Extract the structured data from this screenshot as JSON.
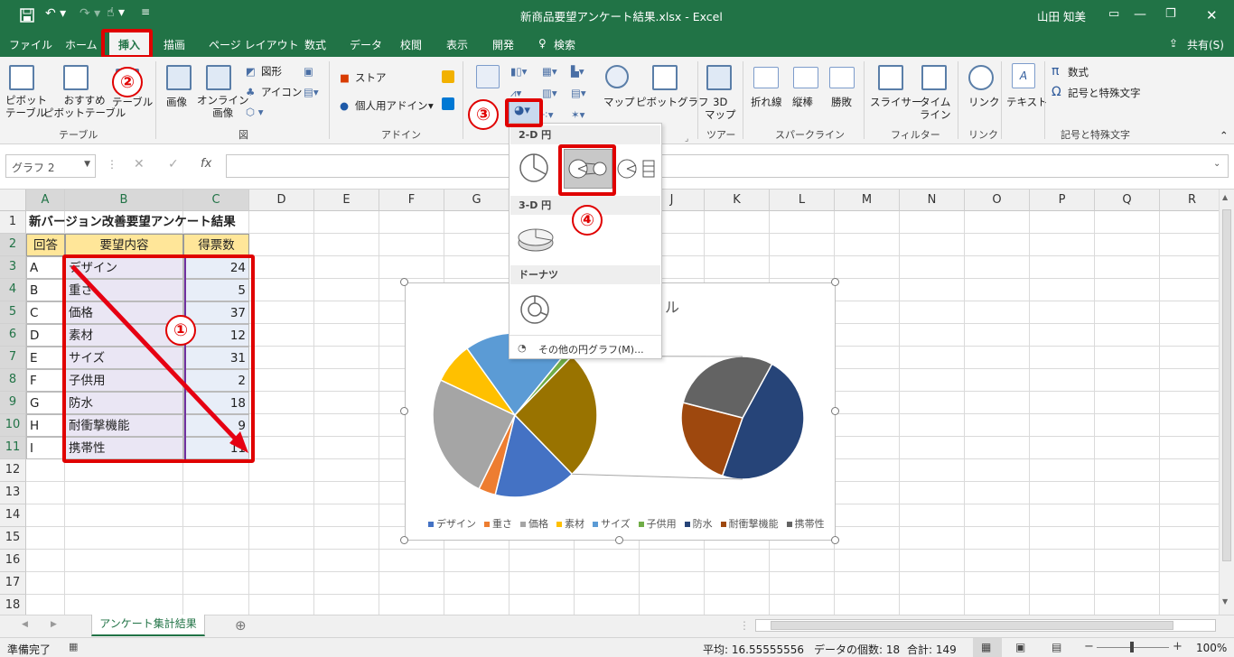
{
  "window": {
    "title": "新商品要望アンケート結果.xlsx  -  Excel",
    "user": "山田 知美"
  },
  "tabs": [
    {
      "label": "ファイル"
    },
    {
      "label": "ホーム"
    },
    {
      "label": "挿入"
    },
    {
      "label": "描画"
    },
    {
      "label": "ページ レイアウト"
    },
    {
      "label": "数式"
    },
    {
      "label": "データ"
    },
    {
      "label": "校閲"
    },
    {
      "label": "表示"
    },
    {
      "label": "開発"
    },
    {
      "label": "検索"
    }
  ],
  "share_label": "共有(S)",
  "ribbon": {
    "pivot": "ピボット\nテーブル",
    "rec_pivot": "おすすめ\nピボットテーブル",
    "table": "テーブル",
    "g_table": "テーブル",
    "image": "画像",
    "online_image": "オンライン\n画像",
    "shapes": "図形",
    "icons": "アイコン",
    "g_figure": "図",
    "store": "ストア",
    "personal_addin": "個人用アドイン",
    "g_addin": "アドイン",
    "map": "マップ",
    "pivotchart": "ピボットグラフ",
    "map3d": "3D\nマップ",
    "g_tour": "ツアー",
    "line": "折れ線",
    "column": "縦棒",
    "winloss": "勝敗",
    "g_spark": "スパークライン",
    "slicer": "スライサー",
    "timeline": "タイム\nライン",
    "g_filter": "フィルター",
    "link": "リンク",
    "g_link": "リンク",
    "text": "テキスト",
    "equation": "数式",
    "symbol": "記号と特殊文字",
    "g_symbol": "記号と特殊文字"
  },
  "namebox": "グラフ 2",
  "columns": [
    "A",
    "B",
    "C",
    "D",
    "E",
    "F",
    "G",
    "H",
    "I",
    "J",
    "K",
    "L",
    "M",
    "N",
    "O",
    "P",
    "Q",
    "R"
  ],
  "rows": [
    "1",
    "2",
    "3",
    "4",
    "5",
    "6",
    "7",
    "8",
    "9",
    "10",
    "11",
    "12",
    "13",
    "14",
    "15",
    "16",
    "17",
    "18"
  ],
  "sheet": {
    "title": "新バージョン改善要望アンケート結果",
    "headers": [
      "回答",
      "要望内容",
      "得票数"
    ],
    "data": [
      [
        "A",
        "デザイン",
        "24"
      ],
      [
        "B",
        "重さ",
        "5"
      ],
      [
        "C",
        "価格",
        "37"
      ],
      [
        "D",
        "素材",
        "12"
      ],
      [
        "E",
        "サイズ",
        "31"
      ],
      [
        "F",
        "子供用",
        "2"
      ],
      [
        "G",
        "防水",
        "18"
      ],
      [
        "H",
        "耐衝撃機能",
        "9"
      ],
      [
        "I",
        "携帯性",
        "11"
      ]
    ]
  },
  "dropdown": {
    "pie2d": "2-D 円",
    "pie3d": "3-D 円",
    "donut": "ドーナツ",
    "more": "その他の円グラフ(M)..."
  },
  "chart": {
    "title_fragment": "ル",
    "legend": [
      "デザイン",
      "重さ",
      "価格",
      "素材",
      "サイズ",
      "子供用",
      "防水",
      "耐衝撃機能",
      "携帯性"
    ],
    "colors": [
      "#4472c4",
      "#ed7d31",
      "#a5a5a5",
      "#ffc000",
      "#5b9bd5",
      "#70ad47",
      "#264478",
      "#9e480e",
      "#636363",
      "#997300"
    ]
  },
  "callouts": [
    "①",
    "②",
    "③",
    "④"
  ],
  "sheet_tab": "アンケート集計結果",
  "status": {
    "ready": "準備完了",
    "avg": "平均: 16.55555556",
    "count": "データの個数: 18",
    "sum": "合計: 149",
    "zoom": "100%"
  }
}
